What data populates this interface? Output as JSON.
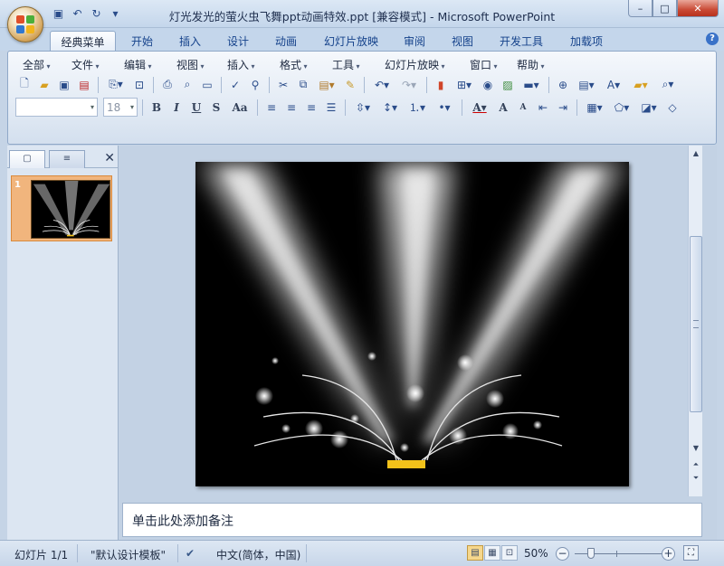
{
  "window": {
    "title": "灯光发光的萤火虫飞舞ppt动画特效.ppt [兼容模式] - Microsoft PowerPoint",
    "controls": [
      "–",
      "□",
      "✕"
    ]
  },
  "quick_access": [
    {
      "icon": "save-icon",
      "glyph": "▣"
    },
    {
      "icon": "undo-icon",
      "glyph": "↶"
    },
    {
      "icon": "redo-icon",
      "glyph": "↻"
    },
    {
      "icon": "customize-icon",
      "glyph": "▾"
    }
  ],
  "ribbon_tabs": [
    "经典菜单",
    "开始",
    "插入",
    "设计",
    "动画",
    "幻灯片放映",
    "审阅",
    "视图",
    "开发工具",
    "加载项"
  ],
  "active_tab": "经典菜单",
  "menus": [
    "全部",
    "文件",
    "编辑",
    "视图",
    "插入",
    "格式",
    "工具",
    "幻灯片放映",
    "窗口",
    "帮助"
  ],
  "toolbar": {
    "font_name": "",
    "font_size": "18",
    "bold": "B",
    "italic": "I",
    "underline": "U",
    "shadow": "S",
    "change_case": "Aa",
    "grow_font": "A",
    "shrink_font": "A"
  },
  "left_pane": {
    "tab_slides": "▢",
    "tab_outline": "≡",
    "close": "✕",
    "slide_number": "1"
  },
  "notes": {
    "placeholder": "单击此处添加备注"
  },
  "status": {
    "slide_info": "幻灯片 1/1",
    "theme": "\"默认设计模板\"",
    "language": "中文(简体，中国)",
    "zoom": "50%",
    "zoom_minus": "−",
    "zoom_plus": "+"
  },
  "colors": {
    "accent_orange": "#f1b57d",
    "stage_bar": "#f3c21a",
    "ribbon_blue": "#c4d6eb"
  }
}
